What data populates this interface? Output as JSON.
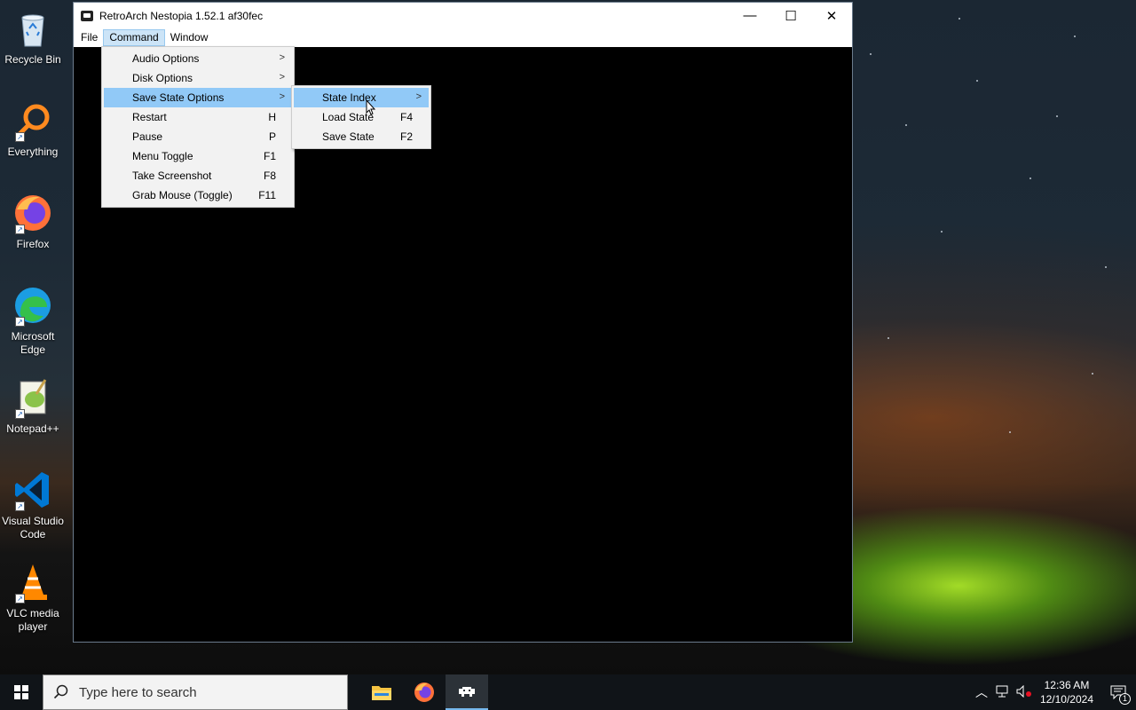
{
  "desktop": {
    "icons": [
      {
        "label": "Recycle Bin"
      },
      {
        "label": "Everything"
      },
      {
        "label": "Firefox"
      },
      {
        "label": "Microsoft Edge"
      },
      {
        "label": "Notepad++"
      },
      {
        "label": "Visual Studio Code"
      },
      {
        "label": "VLC media player"
      }
    ]
  },
  "window": {
    "title": "RetroArch Nestopia 1.52.1 af30fec",
    "controls": {
      "minimize": "—",
      "maximize": "☐",
      "close": "✕"
    },
    "menubar": [
      {
        "label": "File"
      },
      {
        "label": "Command"
      },
      {
        "label": "Window"
      }
    ]
  },
  "command_menu": {
    "items": [
      {
        "label": "Audio Options",
        "shortcut": "",
        "submenu": true
      },
      {
        "label": "Disk Options",
        "shortcut": "",
        "submenu": true
      },
      {
        "label": "Save State Options",
        "shortcut": "",
        "submenu": true
      },
      {
        "label": "Restart",
        "shortcut": "H"
      },
      {
        "label": "Pause",
        "shortcut": "P"
      },
      {
        "label": "Menu Toggle",
        "shortcut": "F1"
      },
      {
        "label": "Take Screenshot",
        "shortcut": "F8"
      },
      {
        "label": "Grab Mouse (Toggle)",
        "shortcut": "F11"
      }
    ]
  },
  "save_state_submenu": {
    "items": [
      {
        "label": "State Index",
        "shortcut": "",
        "submenu": true
      },
      {
        "label": "Load State",
        "shortcut": "F4"
      },
      {
        "label": "Save State",
        "shortcut": "F2"
      }
    ]
  },
  "taskbar": {
    "search_placeholder": "Type here to search",
    "time": "12:36 AM",
    "date": "12/10/2024",
    "notification_count": "1"
  },
  "colors": {
    "menu_highlight": "#91c9f7",
    "menubar_active": "#cce4f7",
    "taskbar": "#101418"
  }
}
